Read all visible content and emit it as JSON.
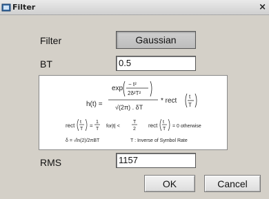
{
  "window": {
    "title": "Filter",
    "close_glyph": "×"
  },
  "form": {
    "filter_label": "Filter",
    "filter_button": "Gaussian",
    "bt_label": "BT",
    "bt_value": "0.5",
    "rms_label": "RMS",
    "rms_value": "1157"
  },
  "formula": {
    "h_lhs": "h(t) =",
    "exp": "exp",
    "minus_t2": "− t²",
    "denom_top": "2δ²T²",
    "sqrt": "√(2π) . δT",
    "times_rect": "* rect",
    "frac_t": "t",
    "frac_T": "T",
    "line2_rect1": "rect",
    "line2_eq1": "=",
    "line2_one": "1",
    "line2_T": "T",
    "line2_for": "for|t| <",
    "line2_T2_top": "T",
    "line2_T2_bot": "2",
    "line2_rect2": "rect",
    "line2_eq0": "= 0   otherwise",
    "line3_delta": "δ = √ln(2)/2πBT",
    "line3_T": "T : Inverse of Symbol Rate"
  },
  "buttons": {
    "ok": "OK",
    "cancel": "Cancel"
  },
  "icons": {
    "app": "window-app-icon",
    "close": "close-icon"
  }
}
